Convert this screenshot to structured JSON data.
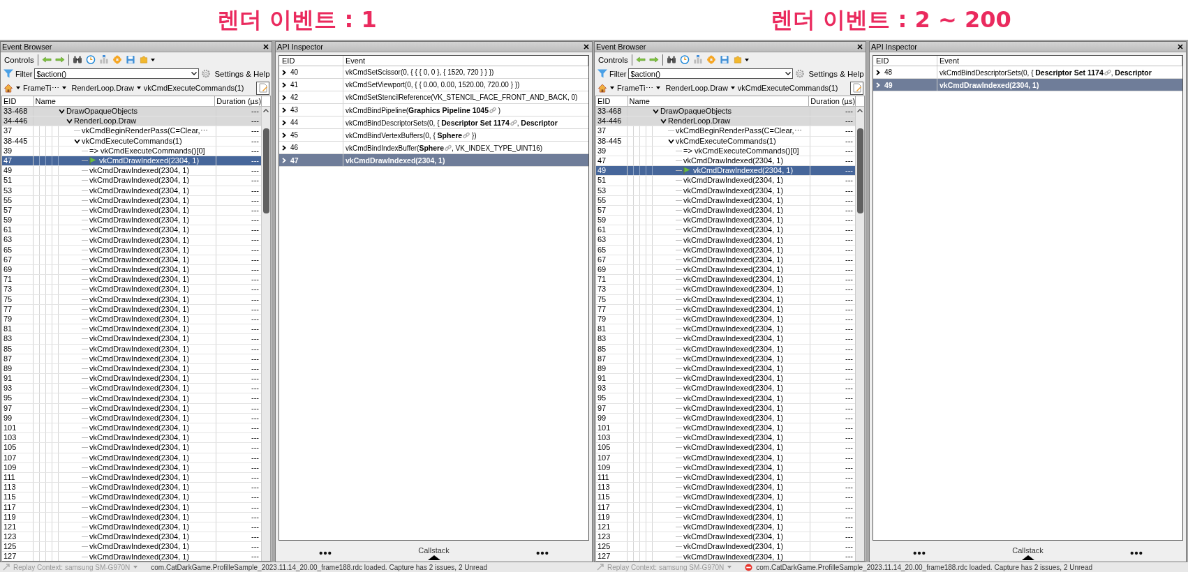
{
  "panels": [
    {
      "heading": "렌더 이벤트 : 1",
      "event_browser": {
        "title": "Event Browser",
        "controls_label": "Controls",
        "filter_label": "Filter",
        "filter_value": "$action()",
        "settings": "Settings & Help",
        "breadcrumbs": [
          "FrameTi⋯",
          "RenderLoop.Draw",
          "vkCmdExecuteCommands(1)"
        ],
        "columns": [
          "EID",
          "Name",
          "Duration (µs)"
        ],
        "rows": [
          {
            "eid": "33-468",
            "name": "DrawOpaqueObjects",
            "duration": "---",
            "kind": "marker",
            "expanded": true,
            "selected": false,
            "children": [
              {
                "eid": "34-446",
                "name": "RenderLoop.Draw",
                "duration": "---",
                "kind": "marker",
                "expanded": true,
                "selected": false,
                "children": [
                  {
                    "eid": "37",
                    "name": "vkCmdBeginRenderPass(C=Clear,⋯",
                    "duration": "---",
                    "kind": "action",
                    "selected": false
                  },
                  {
                    "eid": "38-445",
                    "name": "vkCmdExecuteCommands(1)",
                    "duration": "---",
                    "kind": "action",
                    "expanded": true,
                    "selected": false,
                    "children": [
                      {
                        "eid": "39",
                        "name": "=>  vkCmdExecuteCommands()[0]",
                        "duration": "---",
                        "kind": "action",
                        "selected": false
                      },
                      {
                        "eid": "47",
                        "name": "vkCmdDrawIndexed(2304, 1)",
                        "duration": "---",
                        "kind": "action",
                        "selected": true
                      },
                      {
                        "eid": "49",
                        "name": "vkCmdDrawIndexed(2304, 1)",
                        "duration": "---",
                        "kind": "action",
                        "selected": false
                      },
                      {
                        "eid": "51",
                        "name": "vkCmdDrawIndexed(2304, 1)",
                        "duration": "---",
                        "kind": "action",
                        "selected": false
                      },
                      {
                        "eid": "53",
                        "name": "vkCmdDrawIndexed(2304, 1)",
                        "duration": "---",
                        "kind": "action",
                        "selected": false
                      },
                      {
                        "eid": "55",
                        "name": "vkCmdDrawIndexed(2304, 1)",
                        "duration": "---",
                        "kind": "action",
                        "selected": false
                      },
                      {
                        "eid": "57",
                        "name": "vkCmdDrawIndexed(2304, 1)",
                        "duration": "---",
                        "kind": "action",
                        "selected": false
                      },
                      {
                        "eid": "59",
                        "name": "vkCmdDrawIndexed(2304, 1)",
                        "duration": "---",
                        "kind": "action",
                        "selected": false
                      },
                      {
                        "eid": "61",
                        "name": "vkCmdDrawIndexed(2304, 1)",
                        "duration": "---",
                        "kind": "action",
                        "selected": false
                      },
                      {
                        "eid": "63",
                        "name": "vkCmdDrawIndexed(2304, 1)",
                        "duration": "---",
                        "kind": "action",
                        "selected": false
                      },
                      {
                        "eid": "65",
                        "name": "vkCmdDrawIndexed(2304, 1)",
                        "duration": "---",
                        "kind": "action",
                        "selected": false
                      },
                      {
                        "eid": "67",
                        "name": "vkCmdDrawIndexed(2304, 1)",
                        "duration": "---",
                        "kind": "action",
                        "selected": false
                      },
                      {
                        "eid": "69",
                        "name": "vkCmdDrawIndexed(2304, 1)",
                        "duration": "---",
                        "kind": "action",
                        "selected": false
                      },
                      {
                        "eid": "71",
                        "name": "vkCmdDrawIndexed(2304, 1)",
                        "duration": "---",
                        "kind": "action",
                        "selected": false
                      },
                      {
                        "eid": "73",
                        "name": "vkCmdDrawIndexed(2304, 1)",
                        "duration": "---",
                        "kind": "action",
                        "selected": false
                      },
                      {
                        "eid": "75",
                        "name": "vkCmdDrawIndexed(2304, 1)",
                        "duration": "---",
                        "kind": "action",
                        "selected": false
                      },
                      {
                        "eid": "77",
                        "name": "vkCmdDrawIndexed(2304, 1)",
                        "duration": "---",
                        "kind": "action",
                        "selected": false
                      },
                      {
                        "eid": "79",
                        "name": "vkCmdDrawIndexed(2304, 1)",
                        "duration": "---",
                        "kind": "action",
                        "selected": false
                      },
                      {
                        "eid": "81",
                        "name": "vkCmdDrawIndexed(2304, 1)",
                        "duration": "---",
                        "kind": "action",
                        "selected": false
                      },
                      {
                        "eid": "83",
                        "name": "vkCmdDrawIndexed(2304, 1)",
                        "duration": "---",
                        "kind": "action",
                        "selected": false
                      },
                      {
                        "eid": "85",
                        "name": "vkCmdDrawIndexed(2304, 1)",
                        "duration": "---",
                        "kind": "action",
                        "selected": false
                      },
                      {
                        "eid": "87",
                        "name": "vkCmdDrawIndexed(2304, 1)",
                        "duration": "---",
                        "kind": "action",
                        "selected": false
                      },
                      {
                        "eid": "89",
                        "name": "vkCmdDrawIndexed(2304, 1)",
                        "duration": "---",
                        "kind": "action",
                        "selected": false
                      },
                      {
                        "eid": "91",
                        "name": "vkCmdDrawIndexed(2304, 1)",
                        "duration": "---",
                        "kind": "action",
                        "selected": false
                      },
                      {
                        "eid": "93",
                        "name": "vkCmdDrawIndexed(2304, 1)",
                        "duration": "---",
                        "kind": "action",
                        "selected": false
                      },
                      {
                        "eid": "95",
                        "name": "vkCmdDrawIndexed(2304, 1)",
                        "duration": "---",
                        "kind": "action",
                        "selected": false
                      },
                      {
                        "eid": "97",
                        "name": "vkCmdDrawIndexed(2304, 1)",
                        "duration": "---",
                        "kind": "action",
                        "selected": false
                      },
                      {
                        "eid": "99",
                        "name": "vkCmdDrawIndexed(2304, 1)",
                        "duration": "---",
                        "kind": "action",
                        "selected": false
                      },
                      {
                        "eid": "101",
                        "name": "vkCmdDrawIndexed(2304, 1)",
                        "duration": "---",
                        "kind": "action",
                        "selected": false
                      },
                      {
                        "eid": "103",
                        "name": "vkCmdDrawIndexed(2304, 1)",
                        "duration": "---",
                        "kind": "action",
                        "selected": false
                      },
                      {
                        "eid": "105",
                        "name": "vkCmdDrawIndexed(2304, 1)",
                        "duration": "---",
                        "kind": "action",
                        "selected": false
                      },
                      {
                        "eid": "107",
                        "name": "vkCmdDrawIndexed(2304, 1)",
                        "duration": "---",
                        "kind": "action",
                        "selected": false
                      },
                      {
                        "eid": "109",
                        "name": "vkCmdDrawIndexed(2304, 1)",
                        "duration": "---",
                        "kind": "action",
                        "selected": false
                      },
                      {
                        "eid": "111",
                        "name": "vkCmdDrawIndexed(2304, 1)",
                        "duration": "---",
                        "kind": "action",
                        "selected": false
                      },
                      {
                        "eid": "113",
                        "name": "vkCmdDrawIndexed(2304, 1)",
                        "duration": "---",
                        "kind": "action",
                        "selected": false
                      },
                      {
                        "eid": "115",
                        "name": "vkCmdDrawIndexed(2304, 1)",
                        "duration": "---",
                        "kind": "action",
                        "selected": false
                      },
                      {
                        "eid": "117",
                        "name": "vkCmdDrawIndexed(2304, 1)",
                        "duration": "---",
                        "kind": "action",
                        "selected": false
                      },
                      {
                        "eid": "119",
                        "name": "vkCmdDrawIndexed(2304, 1)",
                        "duration": "---",
                        "kind": "action",
                        "selected": false
                      },
                      {
                        "eid": "121",
                        "name": "vkCmdDrawIndexed(2304, 1)",
                        "duration": "---",
                        "kind": "action",
                        "selected": false
                      },
                      {
                        "eid": "123",
                        "name": "vkCmdDrawIndexed(2304, 1)",
                        "duration": "---",
                        "kind": "action",
                        "selected": false
                      },
                      {
                        "eid": "125",
                        "name": "vkCmdDrawIndexed(2304, 1)",
                        "duration": "---",
                        "kind": "action",
                        "selected": false
                      },
                      {
                        "eid": "127",
                        "name": "vkCmdDrawIndexed(2304, 1)",
                        "duration": "---",
                        "kind": "action",
                        "selected": false
                      }
                    ]
                  }
                ]
              }
            ]
          }
        ]
      },
      "api_inspector": {
        "title": "API Inspector",
        "columns": [
          "EID",
          "Event"
        ],
        "rows": [
          {
            "eid": "40",
            "selected": false,
            "parts": [
              {
                "kind": "plain",
                "text": "vkCmdSetScissor(0, { { { 0, 0 }, { 1520, 720 } } })"
              }
            ]
          },
          {
            "eid": "41",
            "selected": false,
            "parts": [
              {
                "kind": "plain",
                "text": "vkCmdSetViewport(0, { { 0.00, 0.00, 1520.00, 720.00 } })"
              }
            ]
          },
          {
            "eid": "42",
            "selected": false,
            "parts": [
              {
                "kind": "plain",
                "text": "vkCmdSetStencilReference(VK_STENCIL_FACE_FRONT_AND_BACK, 0)"
              }
            ]
          },
          {
            "eid": "43",
            "selected": false,
            "parts": [
              {
                "kind": "plain",
                "text": "vkCmdBindPipeline("
              },
              {
                "kind": "resource",
                "text": "Graphics Pipeline 1045",
                "icon": true
              },
              {
                "kind": "plain",
                "text": " )"
              }
            ]
          },
          {
            "eid": "44",
            "selected": false,
            "parts": [
              {
                "kind": "plain",
                "text": "vkCmdBindDescriptorSets(0, { "
              },
              {
                "kind": "resource",
                "text": "Descriptor Set 1174",
                "icon": true
              },
              {
                "kind": "plain",
                "text": ", "
              },
              {
                "kind": "resource",
                "text": "Descriptor",
                "icon": false
              }
            ]
          },
          {
            "eid": "45",
            "selected": false,
            "parts": [
              {
                "kind": "plain",
                "text": "vkCmdBindVertexBuffers(0, { "
              },
              {
                "kind": "resource",
                "text": "Sphere",
                "icon": true
              },
              {
                "kind": "plain",
                "text": " })"
              }
            ]
          },
          {
            "eid": "46",
            "selected": false,
            "parts": [
              {
                "kind": "plain",
                "text": "vkCmdBindIndexBuffer("
              },
              {
                "kind": "resource",
                "text": "Sphere",
                "icon": true
              },
              {
                "kind": "plain",
                "text": ", VK_INDEX_TYPE_UINT16)"
              }
            ]
          },
          {
            "eid": "47",
            "selected": true,
            "parts": [
              {
                "kind": "plain",
                "text": "vkCmdDrawIndexed(2304, 1)"
              }
            ]
          }
        ],
        "callstack_label": "Callstack"
      },
      "status_bar": {
        "context": "Replay Context: samsung SM-G970N",
        "alert": false,
        "message": "com.CatDarkGame.ProfilleSample_2023.11.14_20.00_frame188.rdc loaded. Capture has 2 issues, 2 Unread"
      }
    },
    {
      "heading": "렌더 이벤트 : 2 ~ 200",
      "event_browser": {
        "title": "Event Browser",
        "controls_label": "Controls",
        "filter_label": "Filter",
        "filter_value": "$action()",
        "settings": "Settings & Help",
        "breadcrumbs": [
          "FrameTi⋯",
          "RenderLoop.Draw",
          "vkCmdExecuteCommands(1)"
        ],
        "columns": [
          "EID",
          "Name",
          "Duration (µs)"
        ],
        "rows": [
          {
            "eid": "33-468",
            "name": "DrawOpaqueObjects",
            "duration": "---",
            "kind": "marker",
            "expanded": true,
            "selected": false,
            "children": [
              {
                "eid": "34-446",
                "name": "RenderLoop.Draw",
                "duration": "---",
                "kind": "marker",
                "expanded": true,
                "selected": false,
                "children": [
                  {
                    "eid": "37",
                    "name": "vkCmdBeginRenderPass(C=Clear,⋯",
                    "duration": "---",
                    "kind": "action",
                    "selected": false
                  },
                  {
                    "eid": "38-445",
                    "name": "vkCmdExecuteCommands(1)",
                    "duration": "---",
                    "kind": "action",
                    "expanded": true,
                    "selected": false,
                    "children": [
                      {
                        "eid": "39",
                        "name": "=>  vkCmdExecuteCommands()[0]",
                        "duration": "---",
                        "kind": "action",
                        "selected": false
                      },
                      {
                        "eid": "47",
                        "name": "vkCmdDrawIndexed(2304, 1)",
                        "duration": "---",
                        "kind": "action",
                        "selected": false
                      },
                      {
                        "eid": "49",
                        "name": "vkCmdDrawIndexed(2304, 1)",
                        "duration": "---",
                        "kind": "action",
                        "selected": true
                      },
                      {
                        "eid": "51",
                        "name": "vkCmdDrawIndexed(2304, 1)",
                        "duration": "---",
                        "kind": "action",
                        "selected": false
                      },
                      {
                        "eid": "53",
                        "name": "vkCmdDrawIndexed(2304, 1)",
                        "duration": "---",
                        "kind": "action",
                        "selected": false
                      },
                      {
                        "eid": "55",
                        "name": "vkCmdDrawIndexed(2304, 1)",
                        "duration": "---",
                        "kind": "action",
                        "selected": false
                      },
                      {
                        "eid": "57",
                        "name": "vkCmdDrawIndexed(2304, 1)",
                        "duration": "---",
                        "kind": "action",
                        "selected": false
                      },
                      {
                        "eid": "59",
                        "name": "vkCmdDrawIndexed(2304, 1)",
                        "duration": "---",
                        "kind": "action",
                        "selected": false
                      },
                      {
                        "eid": "61",
                        "name": "vkCmdDrawIndexed(2304, 1)",
                        "duration": "---",
                        "kind": "action",
                        "selected": false
                      },
                      {
                        "eid": "63",
                        "name": "vkCmdDrawIndexed(2304, 1)",
                        "duration": "---",
                        "kind": "action",
                        "selected": false
                      },
                      {
                        "eid": "65",
                        "name": "vkCmdDrawIndexed(2304, 1)",
                        "duration": "---",
                        "kind": "action",
                        "selected": false
                      },
                      {
                        "eid": "67",
                        "name": "vkCmdDrawIndexed(2304, 1)",
                        "duration": "---",
                        "kind": "action",
                        "selected": false
                      },
                      {
                        "eid": "69",
                        "name": "vkCmdDrawIndexed(2304, 1)",
                        "duration": "---",
                        "kind": "action",
                        "selected": false
                      },
                      {
                        "eid": "71",
                        "name": "vkCmdDrawIndexed(2304, 1)",
                        "duration": "---",
                        "kind": "action",
                        "selected": false
                      },
                      {
                        "eid": "73",
                        "name": "vkCmdDrawIndexed(2304, 1)",
                        "duration": "---",
                        "kind": "action",
                        "selected": false
                      },
                      {
                        "eid": "75",
                        "name": "vkCmdDrawIndexed(2304, 1)",
                        "duration": "---",
                        "kind": "action",
                        "selected": false
                      },
                      {
                        "eid": "77",
                        "name": "vkCmdDrawIndexed(2304, 1)",
                        "duration": "---",
                        "kind": "action",
                        "selected": false
                      },
                      {
                        "eid": "79",
                        "name": "vkCmdDrawIndexed(2304, 1)",
                        "duration": "---",
                        "kind": "action",
                        "selected": false
                      },
                      {
                        "eid": "81",
                        "name": "vkCmdDrawIndexed(2304, 1)",
                        "duration": "---",
                        "kind": "action",
                        "selected": false
                      },
                      {
                        "eid": "83",
                        "name": "vkCmdDrawIndexed(2304, 1)",
                        "duration": "---",
                        "kind": "action",
                        "selected": false
                      },
                      {
                        "eid": "85",
                        "name": "vkCmdDrawIndexed(2304, 1)",
                        "duration": "---",
                        "kind": "action",
                        "selected": false
                      },
                      {
                        "eid": "87",
                        "name": "vkCmdDrawIndexed(2304, 1)",
                        "duration": "---",
                        "kind": "action",
                        "selected": false
                      },
                      {
                        "eid": "89",
                        "name": "vkCmdDrawIndexed(2304, 1)",
                        "duration": "---",
                        "kind": "action",
                        "selected": false
                      },
                      {
                        "eid": "91",
                        "name": "vkCmdDrawIndexed(2304, 1)",
                        "duration": "---",
                        "kind": "action",
                        "selected": false
                      },
                      {
                        "eid": "93",
                        "name": "vkCmdDrawIndexed(2304, 1)",
                        "duration": "---",
                        "kind": "action",
                        "selected": false
                      },
                      {
                        "eid": "95",
                        "name": "vkCmdDrawIndexed(2304, 1)",
                        "duration": "---",
                        "kind": "action",
                        "selected": false
                      },
                      {
                        "eid": "97",
                        "name": "vkCmdDrawIndexed(2304, 1)",
                        "duration": "---",
                        "kind": "action",
                        "selected": false
                      },
                      {
                        "eid": "99",
                        "name": "vkCmdDrawIndexed(2304, 1)",
                        "duration": "---",
                        "kind": "action",
                        "selected": false
                      },
                      {
                        "eid": "101",
                        "name": "vkCmdDrawIndexed(2304, 1)",
                        "duration": "---",
                        "kind": "action",
                        "selected": false
                      },
                      {
                        "eid": "103",
                        "name": "vkCmdDrawIndexed(2304, 1)",
                        "duration": "---",
                        "kind": "action",
                        "selected": false
                      },
                      {
                        "eid": "105",
                        "name": "vkCmdDrawIndexed(2304, 1)",
                        "duration": "---",
                        "kind": "action",
                        "selected": false
                      },
                      {
                        "eid": "107",
                        "name": "vkCmdDrawIndexed(2304, 1)",
                        "duration": "---",
                        "kind": "action",
                        "selected": false
                      },
                      {
                        "eid": "109",
                        "name": "vkCmdDrawIndexed(2304, 1)",
                        "duration": "---",
                        "kind": "action",
                        "selected": false
                      },
                      {
                        "eid": "111",
                        "name": "vkCmdDrawIndexed(2304, 1)",
                        "duration": "---",
                        "kind": "action",
                        "selected": false
                      },
                      {
                        "eid": "113",
                        "name": "vkCmdDrawIndexed(2304, 1)",
                        "duration": "---",
                        "kind": "action",
                        "selected": false
                      },
                      {
                        "eid": "115",
                        "name": "vkCmdDrawIndexed(2304, 1)",
                        "duration": "---",
                        "kind": "action",
                        "selected": false
                      },
                      {
                        "eid": "117",
                        "name": "vkCmdDrawIndexed(2304, 1)",
                        "duration": "---",
                        "kind": "action",
                        "selected": false
                      },
                      {
                        "eid": "119",
                        "name": "vkCmdDrawIndexed(2304, 1)",
                        "duration": "---",
                        "kind": "action",
                        "selected": false
                      },
                      {
                        "eid": "121",
                        "name": "vkCmdDrawIndexed(2304, 1)",
                        "duration": "---",
                        "kind": "action",
                        "selected": false
                      },
                      {
                        "eid": "123",
                        "name": "vkCmdDrawIndexed(2304, 1)",
                        "duration": "---",
                        "kind": "action",
                        "selected": false
                      },
                      {
                        "eid": "125",
                        "name": "vkCmdDrawIndexed(2304, 1)",
                        "duration": "---",
                        "kind": "action",
                        "selected": false
                      },
                      {
                        "eid": "127",
                        "name": "vkCmdDrawIndexed(2304, 1)",
                        "duration": "---",
                        "kind": "action",
                        "selected": false
                      }
                    ]
                  }
                ]
              }
            ]
          }
        ]
      },
      "api_inspector": {
        "title": "API Inspector",
        "columns": [
          "EID",
          "Event"
        ],
        "rows": [
          {
            "eid": "48",
            "selected": false,
            "parts": [
              {
                "kind": "plain",
                "text": "vkCmdBindDescriptorSets(0, { "
              },
              {
                "kind": "resource",
                "text": "Descriptor Set 1174",
                "icon": true
              },
              {
                "kind": "plain",
                "text": ", "
              },
              {
                "kind": "resource",
                "text": "Descriptor",
                "icon": false
              }
            ]
          },
          {
            "eid": "49",
            "selected": true,
            "parts": [
              {
                "kind": "plain",
                "text": "vkCmdDrawIndexed(2304, 1)"
              }
            ]
          }
        ],
        "callstack_label": "Callstack"
      },
      "status_bar": {
        "context": "Replay Context: samsung SM-G970N",
        "alert": true,
        "message": "com.CatDarkGame.ProfilleSample_2023.11.14_20.00_frame188.rdc loaded. Capture has 2 issues, 2 Unread"
      }
    }
  ]
}
